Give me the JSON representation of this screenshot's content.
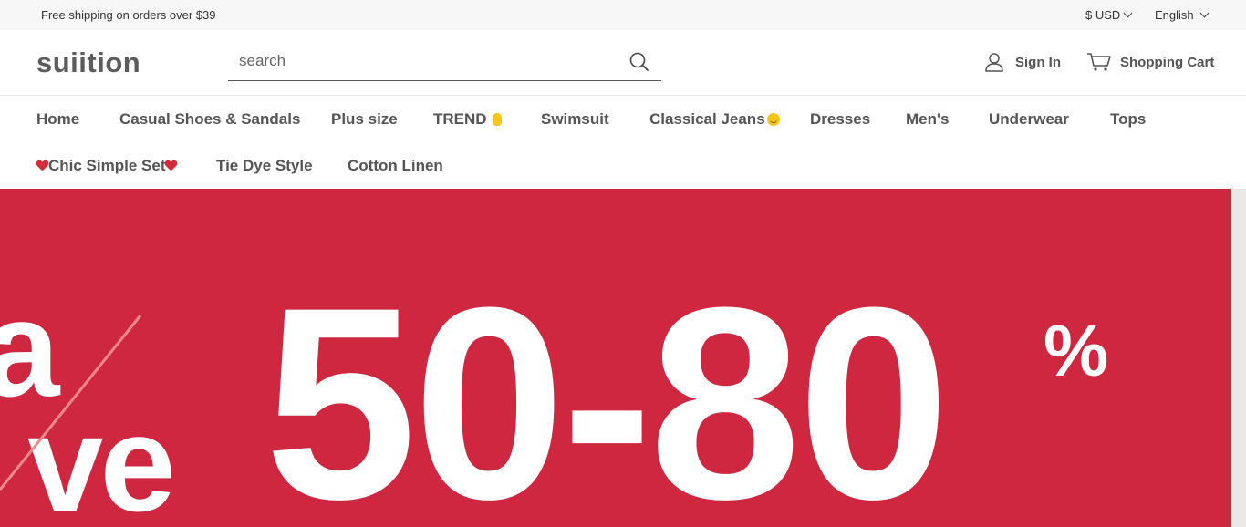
{
  "topbar": {
    "shipping_text": "Free shipping on orders over $39",
    "currency": "$ USD",
    "language": "English"
  },
  "header": {
    "logo": "suiition",
    "search_placeholder": "search",
    "search_value": "",
    "sign_in": "Sign In",
    "cart": "Shopping Cart"
  },
  "nav": {
    "items": [
      {
        "label": "Home"
      },
      {
        "label": "Casual Shoes & Sandals"
      },
      {
        "label": "Plus size"
      },
      {
        "label": "TREND"
      },
      {
        "label": "Swimsuit"
      },
      {
        "label": "Classical Jeans"
      },
      {
        "label": "Dresses"
      },
      {
        "label": "Men's"
      },
      {
        "label": "Underwear"
      },
      {
        "label": "Tops"
      },
      {
        "label": "Chic Simple Set"
      },
      {
        "label": "Tie Dye Style"
      },
      {
        "label": "Cotton Linen"
      }
    ]
  },
  "banner": {
    "fragment_top": "a",
    "fragment_bottom": "ve",
    "discount": "50-80",
    "percent": "%",
    "background_color": "#cf2740"
  },
  "icons": {
    "search": "search-icon",
    "user": "user-icon",
    "cart": "cart-icon",
    "chevron": "chevron-down-icon"
  }
}
